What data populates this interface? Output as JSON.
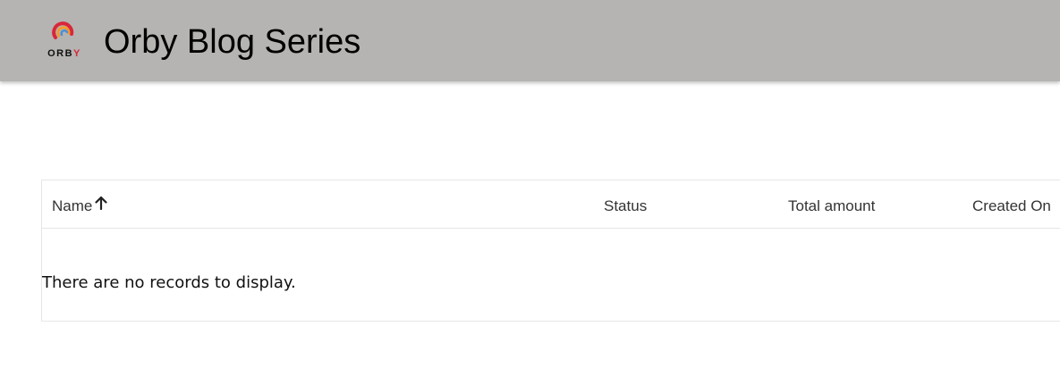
{
  "header": {
    "logo_text_main": "ORB",
    "logo_text_accent": "Y",
    "title": "Orby Blog Series",
    "background_color": "#b5b4b2"
  },
  "table": {
    "columns": [
      {
        "label": "Name",
        "sorted": "ascending",
        "sort_icon": "arrow-up-icon"
      },
      {
        "label": "Status"
      },
      {
        "label": "Total amount"
      },
      {
        "label": "Created On"
      }
    ],
    "rows": [],
    "empty_message": "There are no records to display."
  },
  "colors": {
    "logo_red": "#d9263a",
    "logo_orange": "#f29a2e",
    "logo_blue": "#4a8fd8"
  }
}
